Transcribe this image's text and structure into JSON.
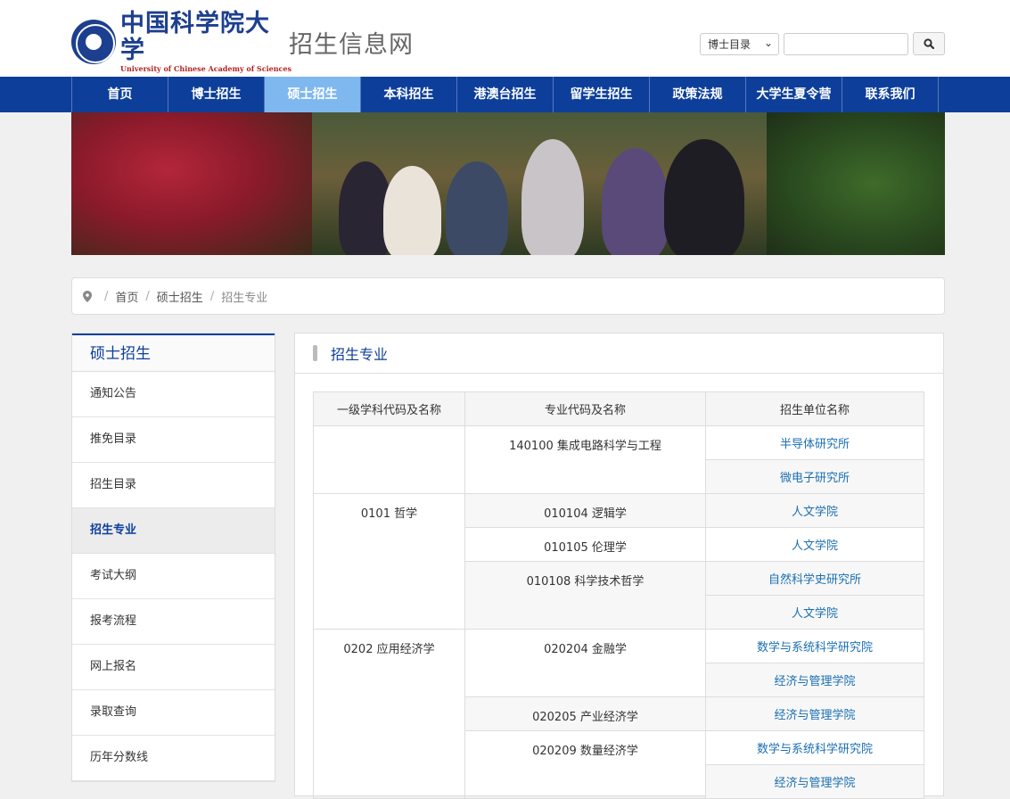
{
  "header": {
    "logo_cn": "中国科学院大学",
    "logo_en": "University of Chinese Academy of Sciences",
    "site_name": "招生信息网",
    "search": {
      "category": "博士目录",
      "button_icon": "search-icon"
    }
  },
  "nav": [
    "首页",
    "博士招生",
    "硕士招生",
    "本科招生",
    "港澳台招生",
    "留学生招生",
    "政策法规",
    "大学生夏令营",
    "联系我们"
  ],
  "nav_active_index": 2,
  "breadcrumb": {
    "home": "首页",
    "level1": "硕士招生",
    "current": "招生专业"
  },
  "sidebar": {
    "title": "硕士招生",
    "items": [
      "通知公告",
      "推免目录",
      "招生目录",
      "招生专业",
      "考试大纲",
      "报考流程",
      "网上报名",
      "录取查询",
      "历年分数线"
    ],
    "active_index": 3
  },
  "main": {
    "title": "招生专业",
    "table": {
      "headers": [
        "一级学科代码及名称",
        "专业代码及名称",
        "招生单位名称"
      ],
      "rows": [
        {
          "discipline": "",
          "major": "140100 集成电路科学与工程",
          "units": [
            "半导体研究所",
            "微电子研究所"
          ]
        },
        {
          "discipline": "0101 哲学",
          "major": "010104 逻辑学",
          "units": [
            "人文学院"
          ]
        },
        {
          "discipline": "",
          "major": "010105 伦理学",
          "units": [
            "人文学院"
          ]
        },
        {
          "discipline": "",
          "major": "010108 科学技术哲学",
          "units": [
            "自然科学史研究所",
            "人文学院"
          ]
        },
        {
          "discipline": "0202 应用经济学",
          "major": "020204 金融学",
          "units": [
            "数学与系统科学研究院",
            "经济与管理学院"
          ]
        },
        {
          "discipline": "",
          "major": "020205 产业经济学",
          "units": [
            "经济与管理学院"
          ]
        },
        {
          "discipline": "",
          "major": "020209 数量经济学",
          "units": [
            "数学与系统科学研究院",
            "经济与管理学院"
          ]
        }
      ]
    }
  },
  "colors": {
    "brand_blue": "#0d3f9a",
    "nav_active": "#7fb8ee",
    "link": "#1a6fb3"
  }
}
